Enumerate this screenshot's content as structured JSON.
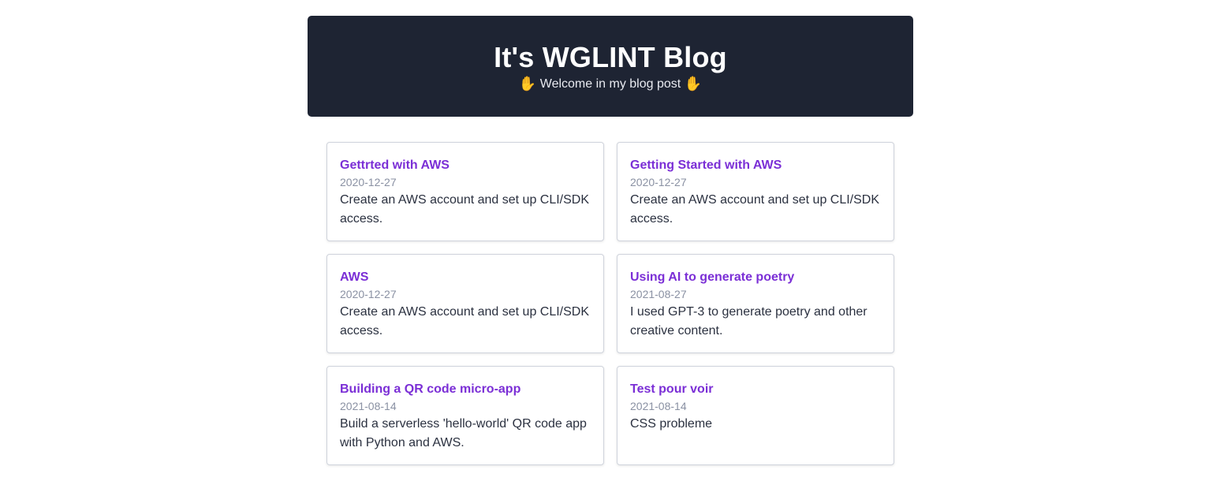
{
  "header": {
    "title": "It's WGLINT Blog",
    "subtitle": "Welcome in my blog post",
    "wave_icon": "raised-hand-icon"
  },
  "posts": [
    {
      "title": "Gettrted with AWS",
      "date": "2020-12-27",
      "description": "Create an AWS account and set up CLI/SDK access."
    },
    {
      "title": "Getting Started with AWS",
      "date": "2020-12-27",
      "description": "Create an AWS account and set up CLI/SDK access."
    },
    {
      "title": "AWS",
      "date": "2020-12-27",
      "description": "Create an AWS account and set up CLI/SDK access."
    },
    {
      "title": "Using AI to generate poetry",
      "date": "2021-08-27",
      "description": "I used GPT-3 to generate poetry and other creative content."
    },
    {
      "title": "Building a QR code micro-app",
      "date": "2021-08-14",
      "description": "Build a serverless 'hello-world' QR code app with Python and AWS."
    },
    {
      "title": "Test pour voir",
      "date": "2021-08-14",
      "description": "CSS probleme"
    }
  ],
  "colors": {
    "header_bg": "#1e2433",
    "accent": "#7b2fd6",
    "date": "#8a91a3"
  }
}
